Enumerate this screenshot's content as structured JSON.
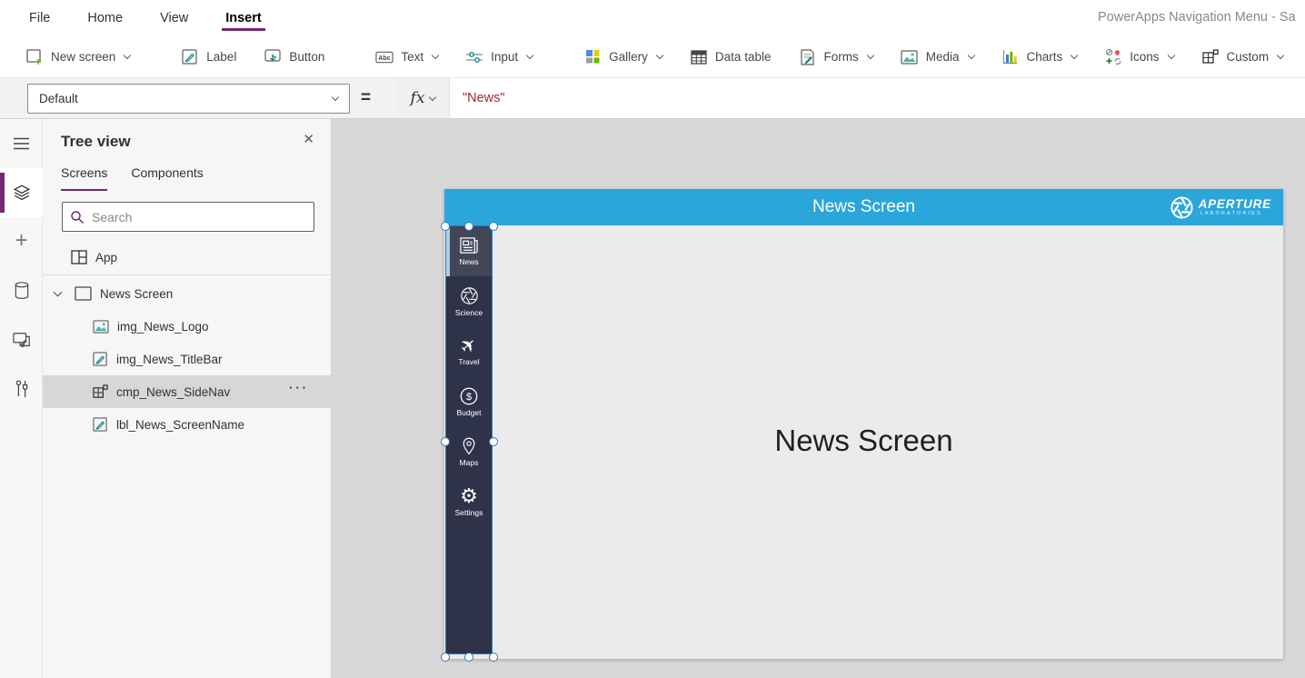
{
  "window": {
    "title": "PowerApps Navigation Menu - Sa"
  },
  "menu": {
    "items": [
      {
        "label": "File"
      },
      {
        "label": "Home"
      },
      {
        "label": "View"
      },
      {
        "label": "Insert",
        "active": true
      }
    ]
  },
  "ribbon": {
    "items": [
      {
        "label": "New screen",
        "icon": "new-screen-icon",
        "dropdown": true
      },
      {
        "label": "Label",
        "icon": "label-icon",
        "dropdown": false
      },
      {
        "label": "Button",
        "icon": "button-icon",
        "dropdown": false
      },
      {
        "label": "Text",
        "icon": "text-icon",
        "dropdown": true
      },
      {
        "label": "Input",
        "icon": "input-icon",
        "dropdown": true
      },
      {
        "label": "Gallery",
        "icon": "gallery-icon",
        "dropdown": true
      },
      {
        "label": "Data table",
        "icon": "data-table-icon",
        "dropdown": false
      },
      {
        "label": "Forms",
        "icon": "forms-icon",
        "dropdown": true
      },
      {
        "label": "Media",
        "icon": "media-icon",
        "dropdown": true
      },
      {
        "label": "Charts",
        "icon": "charts-icon",
        "dropdown": true
      },
      {
        "label": "Icons",
        "icon": "icons-icon",
        "dropdown": true
      },
      {
        "label": "Custom",
        "icon": "custom-icon",
        "dropdown": true
      }
    ],
    "right_icon": "molecule-icon"
  },
  "formula_bar": {
    "property": "Default",
    "equals": "=",
    "fx": "fx",
    "formula": "\"News\""
  },
  "left_rail": {
    "icons": [
      "hamburger-icon",
      "layers-icon",
      "plus-icon",
      "database-icon",
      "media-screens-icon",
      "tools-icon"
    ],
    "selected": "layers-icon"
  },
  "tree_panel": {
    "title": "Tree view",
    "close": "✕",
    "tabs": [
      {
        "label": "Screens",
        "active": true
      },
      {
        "label": "Components",
        "active": false
      }
    ],
    "search_placeholder": "Search",
    "app_item": {
      "label": "App"
    },
    "screen_node": {
      "label": "News Screen"
    },
    "children": [
      {
        "label": "img_News_Logo",
        "icon": "image-icon",
        "selected": false
      },
      {
        "label": "img_News_TitleBar",
        "icon": "label-icon",
        "selected": false
      },
      {
        "label": "cmp_News_SideNav",
        "icon": "component-icon",
        "selected": true,
        "ellipsis": "···"
      },
      {
        "label": "lbl_News_ScreenName",
        "icon": "label-icon",
        "selected": false
      }
    ]
  },
  "canvas": {
    "titlebar_text": "News Screen",
    "logo": {
      "name": "APERTURE",
      "sub": "LABORATORIES"
    },
    "nav_items": [
      {
        "label": "News",
        "icon": "news-icon",
        "selected": true
      },
      {
        "label": "Science",
        "icon": "science-icon",
        "selected": false
      },
      {
        "label": "Travel",
        "icon": "travel-icon",
        "selected": false
      },
      {
        "label": "Budget",
        "icon": "budget-icon",
        "selected": false
      },
      {
        "label": "Maps",
        "icon": "maps-icon",
        "selected": false
      },
      {
        "label": "Settings",
        "icon": "settings-icon",
        "selected": false
      }
    ],
    "body_label": "News Screen"
  },
  "colors": {
    "accent_purple": "#742774",
    "titlebar_blue": "#2BA6DB",
    "nav_dark": "#2F3349",
    "nav_selected": "#414659",
    "nav_accent": "#A9CFE9",
    "selection_blue": "#2A79C9",
    "formula_string_red": "#A4262C",
    "workspace_gray": "#D8D8D8",
    "screen_bg": "#EBEBEB"
  }
}
